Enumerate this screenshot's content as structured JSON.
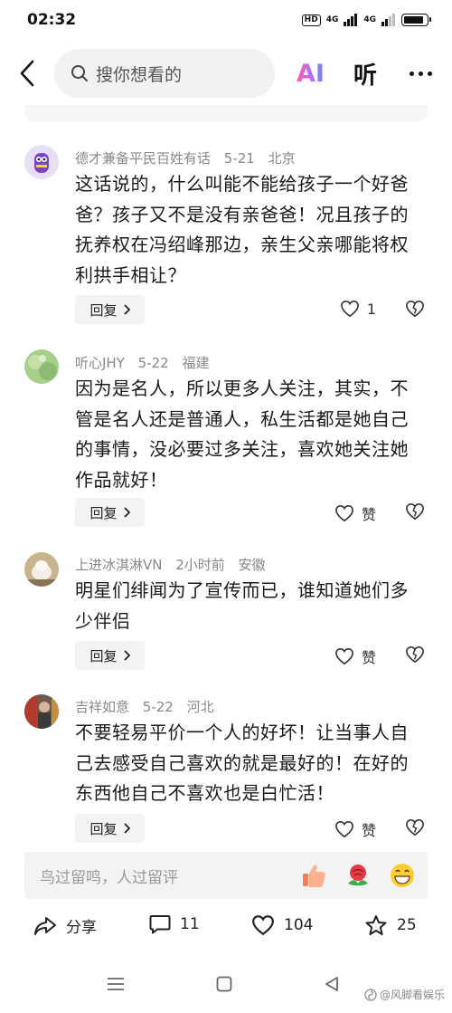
{
  "status_bar": {
    "time": "02:32",
    "hd": "HD",
    "net1": "4G",
    "net2": "4G"
  },
  "top_bar": {
    "search_placeholder": "搜你想看的",
    "ai_label": "AI",
    "listen_label": "听"
  },
  "comments": [
    {
      "author": "德才兼备平民百姓有话",
      "date": "5-21",
      "location": "北京",
      "text": "这话说的，什么叫能不能给孩子一个好爸爸？孩子又不是没有亲爸爸！况且孩子的抚养权在冯绍峰那边，亲生父亲哪能将权利拱手相让？",
      "reply_label": "回复",
      "likes": "1"
    },
    {
      "author": "听心JHY",
      "date": "5-22",
      "location": "福建",
      "text": "因为是名人，所以更多人关注，其实，不管是名人还是普通人，私生活都是她自己的事情，没必要过多关注，喜欢她关注她作品就好！",
      "reply_label": "回复",
      "likes": "赞"
    },
    {
      "author": "上进冰淇淋VN",
      "date": "2小时前",
      "location": "安徽",
      "text": "明星们绯闻为了宣传而已，谁知道她们多少伴侣",
      "reply_label": "回复",
      "likes": "赞"
    },
    {
      "author": "吉祥如意",
      "date": "5-22",
      "location": "河北",
      "text": "不要轻易平价一个人的好坏！让当事人自己去感受自己喜欢的就是最好的！在好的东西他自己不喜欢也是白忙活！",
      "reply_label": "回复",
      "likes": "赞"
    }
  ],
  "input_bar": {
    "placeholder": "鸟过留鸣，人过留评"
  },
  "actions": {
    "share_label": "分享",
    "comments_count": "11",
    "likes_count": "104",
    "favorites_count": "25"
  },
  "watermark": "@风脚看娱乐",
  "colors": {
    "accent_gradient": [
      "#ff5ca8",
      "#b06cff",
      "#4f8dff"
    ],
    "meta_gray": "#888888",
    "chip_bg": "#f3f3f3"
  }
}
